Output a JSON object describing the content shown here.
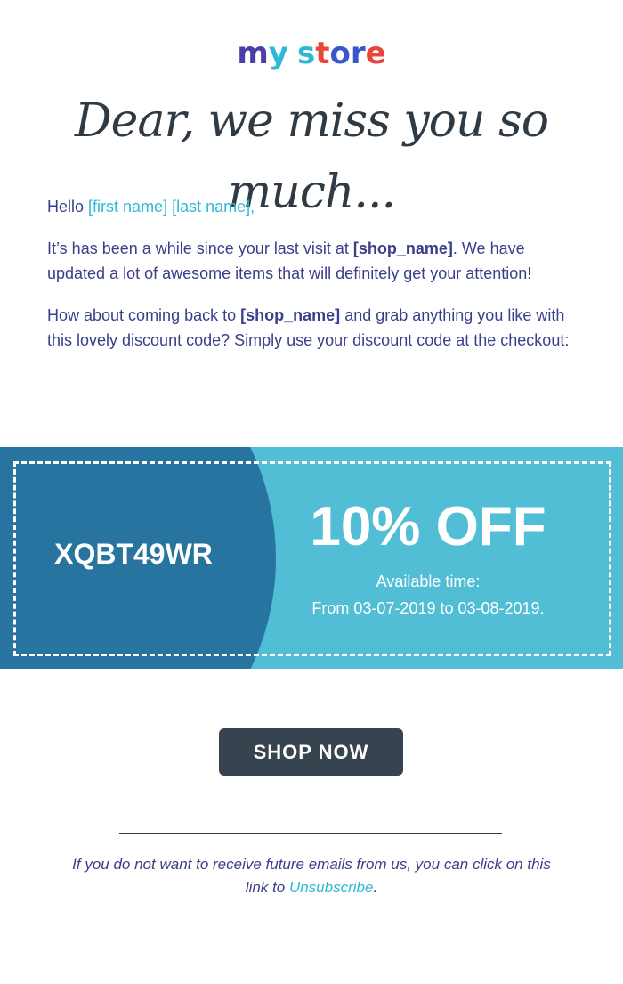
{
  "logo": {
    "letters": [
      {
        "char": "m",
        "color": "#4a3fa8"
      },
      {
        "char": "y",
        "color": "#2fb8d6"
      },
      {
        "char": "s",
        "color": "#2fb8d6"
      },
      {
        "char": "t",
        "color": "#e8463a"
      },
      {
        "char": "o",
        "color": "#3a57c8"
      },
      {
        "char": "r",
        "color": "#3a57c8"
      },
      {
        "char": "e",
        "color": "#e8463a"
      }
    ]
  },
  "headline": "Dear, we miss you so much...",
  "greeting": {
    "hello": "Hello",
    "first_name": "[first name]",
    "last_name": "[last name]",
    "comma": ","
  },
  "paragraph1": {
    "before": "It’s has been a while since your last visit at",
    "shop": "[shop_name]",
    "after": ". We have updated a lot of awesome items that will definitely get your attention!"
  },
  "paragraph2": {
    "before": "How about coming back to",
    "shop": "[shop_name]",
    "after": "and grab anything you like with this lovely discount code? Simply use your discount code at the checkout:"
  },
  "coupon": {
    "code": "XQBT49WR",
    "discount": "10% OFF",
    "available_label": "Available time:",
    "available_range": "From 03-07-2019 to 03-08-2019."
  },
  "cta": {
    "label": "SHOP NOW"
  },
  "footer": {
    "text": "If you do not want to receive future emails from us, you can click on this link to",
    "link": "Unsubscribe",
    "period": "."
  },
  "colors": {
    "text": "#3a3f8a",
    "accent": "#2fb8d6",
    "coupon_dark": "#2874a0",
    "coupon_light": "#52bed6",
    "button": "#37444f"
  }
}
